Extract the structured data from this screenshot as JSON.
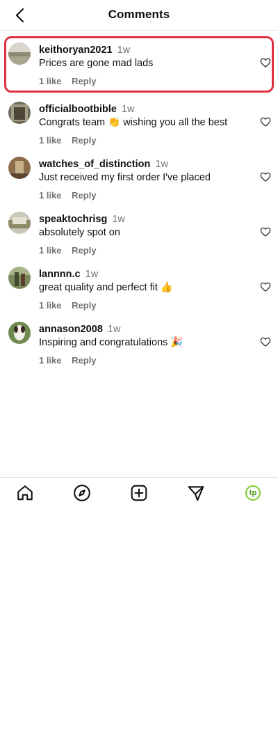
{
  "header": {
    "title": "Comments"
  },
  "comments": [
    {
      "username": "keithoryan2021",
      "time": "1w",
      "text": "Prices are gone mad lads",
      "likes": "1 like",
      "reply": "Reply"
    },
    {
      "username": "officialbootbible",
      "time": "1w",
      "text": "Congrats team 👏 wishing you all the best",
      "likes": "1 like",
      "reply": "Reply"
    },
    {
      "username": "watches_of_distinction",
      "time": "1w",
      "text": "Just received my first order I've placed",
      "likes": "1 like",
      "reply": "Reply"
    },
    {
      "username": "speaktochrisg",
      "time": "1w",
      "text": "absolutely spot on",
      "likes": "1 like",
      "reply": "Reply"
    },
    {
      "username": "lannnn.c",
      "time": "1w",
      "text": "great quality and perfect fit 👍",
      "likes": "1 like",
      "reply": "Reply"
    },
    {
      "username": "annason2008",
      "time": "1w",
      "text": "Inspiring and congratulations 🎉",
      "likes": "1 like",
      "reply": "Reply"
    }
  ],
  "tabbar": {
    "items": [
      "home-icon",
      "explore-compass-icon",
      "create-plus-icon",
      "direct-send-icon",
      "profile-avatar"
    ],
    "profile_initials": "tp"
  },
  "colors": {
    "highlight": "#e0303e",
    "secondary_text": "#737373",
    "profile_ring": "#7ccf2a"
  }
}
